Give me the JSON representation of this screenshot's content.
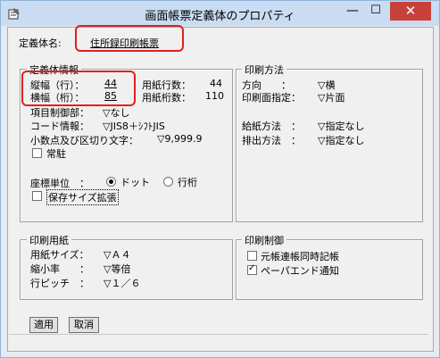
{
  "window": {
    "title": "画面帳票定義体のプロパティ",
    "min": "—",
    "max": "☐",
    "close": "✕"
  },
  "definition": {
    "name_label": "定義体名:",
    "name_value": "住所録印刷帳票"
  },
  "def_info": {
    "title": "定義体情報",
    "rows_label": "縦幅（行）：",
    "rows_value": "44",
    "cols_label": "横幅（桁）：",
    "cols_value": "85",
    "paper_rows_label": "用紙行数：",
    "paper_rows_value": "44",
    "paper_cols_label": "用紙桁数：",
    "paper_cols_value": "110",
    "item_ctrl_label": "項目制御部：",
    "item_ctrl_value": "▽なし",
    "code_label": "コード情報：",
    "code_value": "▽JIS8＋ｼﾌﾄJIS",
    "decimal_label": "小数点及び区切り文字：",
    "decimal_value": "▽9,999.9",
    "resident_label": "常駐",
    "coord_label": "座標単位　：",
    "coord_dot": "ドット",
    "coord_rowcol": "行桁",
    "expand_label": "保存サイズ拡張"
  },
  "print_method": {
    "title": "印刷方法",
    "direction_label": "方向　　：",
    "direction_value": "▽横",
    "side_label": "印刷面指定：",
    "side_value": "▽片面",
    "feed_label": "給紙方法　：",
    "feed_value": "▽指定なし",
    "eject_label": "排出方法　：",
    "eject_value": "▽指定なし"
  },
  "paper": {
    "title": "印刷用紙",
    "size_label": "用紙サイズ：",
    "size_value": "▽Ａ４",
    "scale_label": "縮小率　　：",
    "scale_value": "▽等倍",
    "pitch_label": "行ピッチ　：",
    "pitch_value": "▽１／６"
  },
  "print_control": {
    "title": "印刷制御",
    "ledger_label": "元帳連帳同時記帳",
    "ledger_checked": false,
    "paperend_label": "ペーパエンド通知",
    "paperend_checked": true
  },
  "buttons": {
    "apply": "適用",
    "cancel": "取消"
  }
}
